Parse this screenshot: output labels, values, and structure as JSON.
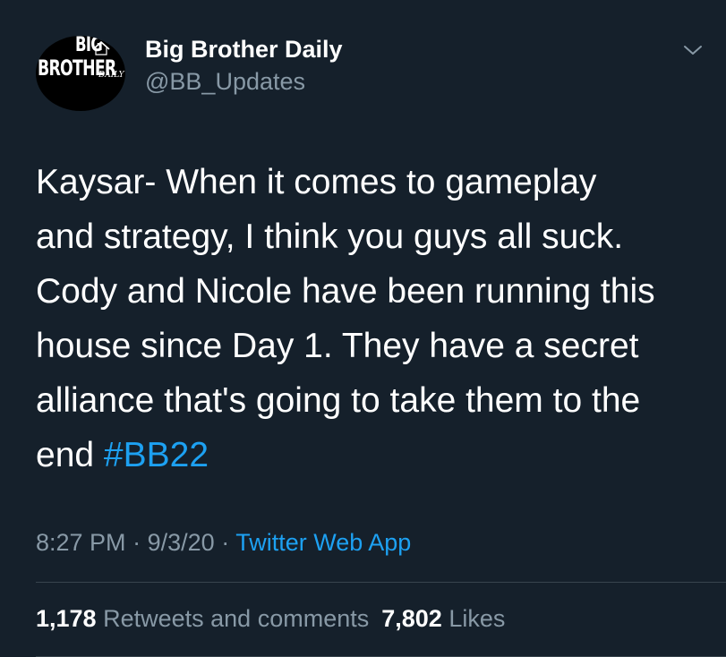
{
  "author": {
    "name": "Big Brother Daily",
    "handle": "@BB_Updates",
    "avatar_logo": {
      "line1": "BIG",
      "line2": "BROTHER",
      "tag": "DAILY"
    }
  },
  "tweet": {
    "lines": [
      "Kaysar- When it comes to gameplay",
      "and strategy, I think you guys all suck.",
      "Cody and Nicole have been running this",
      "house since Day 1. They have a secret",
      "alliance that's going to take them to the"
    ],
    "last_line_text": "end",
    "hashtag": "#BB22"
  },
  "meta": {
    "time": "8:27 PM",
    "separator": "·",
    "date": "9/3/20",
    "source": "Twitter Web App"
  },
  "stats": {
    "retweets_count": "1,178",
    "retweets_label": "Retweets and comments",
    "likes_count": "7,802",
    "likes_label": "Likes"
  },
  "icons": {
    "menu": "chevron-down-icon",
    "logo_house": "house-icon"
  },
  "colors": {
    "background": "#15202b",
    "text": "#ffffff",
    "secondary_text": "#8899a6",
    "accent": "#1da1f2",
    "divider": "#38444d"
  }
}
